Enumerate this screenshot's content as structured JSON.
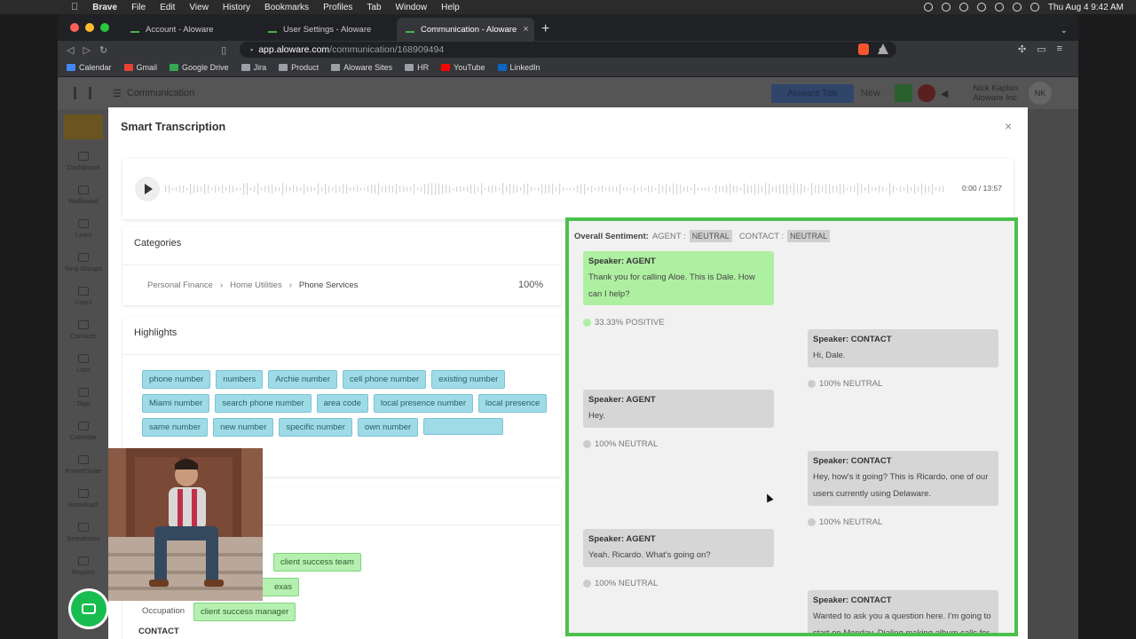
{
  "menubar": {
    "items": [
      "Brave",
      "File",
      "Edit",
      "View",
      "History",
      "Bookmarks",
      "Profiles",
      "Tab",
      "Window",
      "Help"
    ],
    "clock": "Thu Aug 4  9:42 AM"
  },
  "tabs": [
    {
      "label": "Account - Aloware"
    },
    {
      "label": "User Settings - Aloware"
    },
    {
      "label": "Communication - Aloware"
    }
  ],
  "url": {
    "host": "app.aloware.com",
    "path": "/communication/168909494"
  },
  "bookmarks": [
    "Calendar",
    "Gmail",
    "Google Drive",
    "Jira",
    "Product",
    "Aloware Sites",
    "HR",
    "YouTube",
    "LinkedIn"
  ],
  "app": {
    "header_title": "Communication",
    "talk_button": "Aloware Talk",
    "new_label": "New",
    "user_name": "Nick Kaplun",
    "company": "Aloware Inc",
    "initials": "NK"
  },
  "sidebar": [
    "Dashboard",
    "Wallboard",
    "Lines",
    "Ring Groups",
    "Users",
    "Contacts",
    "Lists",
    "Tags",
    "Calendar",
    "PowerDialer",
    "Broadcast",
    "Sequences",
    "Reports"
  ],
  "modal": {
    "title": "Smart Transcription",
    "close": "×",
    "player_time": "0:00 / 13:57"
  },
  "categories": {
    "title": "Categories",
    "crumbs": [
      "Personal Finance",
      "Home Utilities",
      "Phone Services"
    ],
    "percent": "100%"
  },
  "highlights": {
    "title": "Highlights",
    "tags": [
      "phone number",
      "numbers",
      "Archie number",
      "cell phone number",
      "existing number",
      "Miami number",
      "search phone number",
      "area code",
      "local presence number",
      "local presence",
      "same number",
      "new number",
      "specific number",
      "own number"
    ]
  },
  "keywords": {
    "tags": [
      "client success team",
      "exas"
    ],
    "occupation_label": "Occupation",
    "occupation_value": "client success manager",
    "contact_label": "CONTACT"
  },
  "sentiment": {
    "label": "Overall Sentiment:",
    "agent_label": "AGENT :",
    "agent_value": "NEUTRAL",
    "contact_label": "CONTACT :",
    "contact_value": "NEUTRAL"
  },
  "transcript": [
    {
      "speaker": "Speaker: AGENT",
      "text": "Thank you for calling Aloe. This is Dale. How can I help?",
      "sentiment": "33.33% POSITIVE"
    },
    {
      "speaker": "Speaker: CONTACT",
      "text": "Hi, Dale.",
      "sentiment": "100% NEUTRAL"
    },
    {
      "speaker": "Speaker: AGENT",
      "text": "Hey.",
      "sentiment": "100% NEUTRAL"
    },
    {
      "speaker": "Speaker: CONTACT",
      "text": "Hey, how's it going? This is Ricardo, one of our users currently using Delaware.",
      "sentiment": "100% NEUTRAL"
    },
    {
      "speaker": "Speaker: AGENT",
      "text": "Yeah. Ricardo. What's going on?",
      "sentiment": "100% NEUTRAL"
    },
    {
      "speaker": "Speaker: CONTACT",
      "text": "Wanted to ask you a question here. I'm going to start on Monday. Dialing making album calls for"
    }
  ],
  "colors": {
    "accent_green": "#4cc04c",
    "highlight_tag": "#9edbe6",
    "positive": "#aef0a2"
  }
}
